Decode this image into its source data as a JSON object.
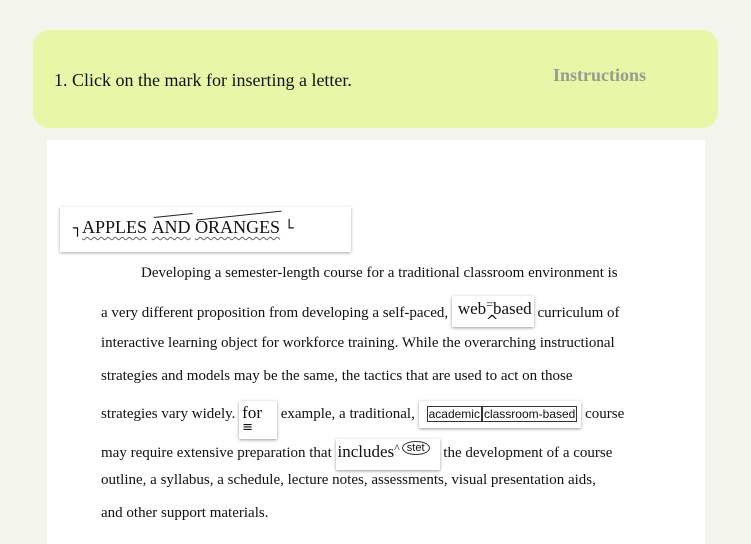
{
  "banner": {
    "question": "1. Click on the mark for inserting a letter.",
    "instructions_label": "Instructions"
  },
  "document": {
    "title": {
      "open_mark": "┐",
      "word1": "APPLES",
      "word2": "AND",
      "word3": "ORANGES",
      "close_mark": "└"
    },
    "lines": [
      "Developing a semester-length course for a traditional classroom environment is",
      "a very different proposition from developing a self-paced,",
      "curriculum of",
      "interactive learning object for workforce training. While the overarching instructional",
      "strategies and models may be the same, the tactics that are used to act on those",
      "strategies vary widely.",
      "example, a traditional,",
      "course",
      "may require extensive preparation that",
      "the development of a course",
      "outline, a syllabus, a schedule, lecture notes, assessments, visual presentation aids,",
      "and other support materials."
    ],
    "edits": {
      "web": "web",
      "hyphen_mark": "=",
      "based": "based",
      "insert_caret": "^",
      "for_word": "for",
      "capital_mark": "≡",
      "academic": "academic",
      "classroom_based": "classroom-based",
      "includes": "includes",
      "insert_caret_small": "^",
      "stet": "stet"
    }
  }
}
